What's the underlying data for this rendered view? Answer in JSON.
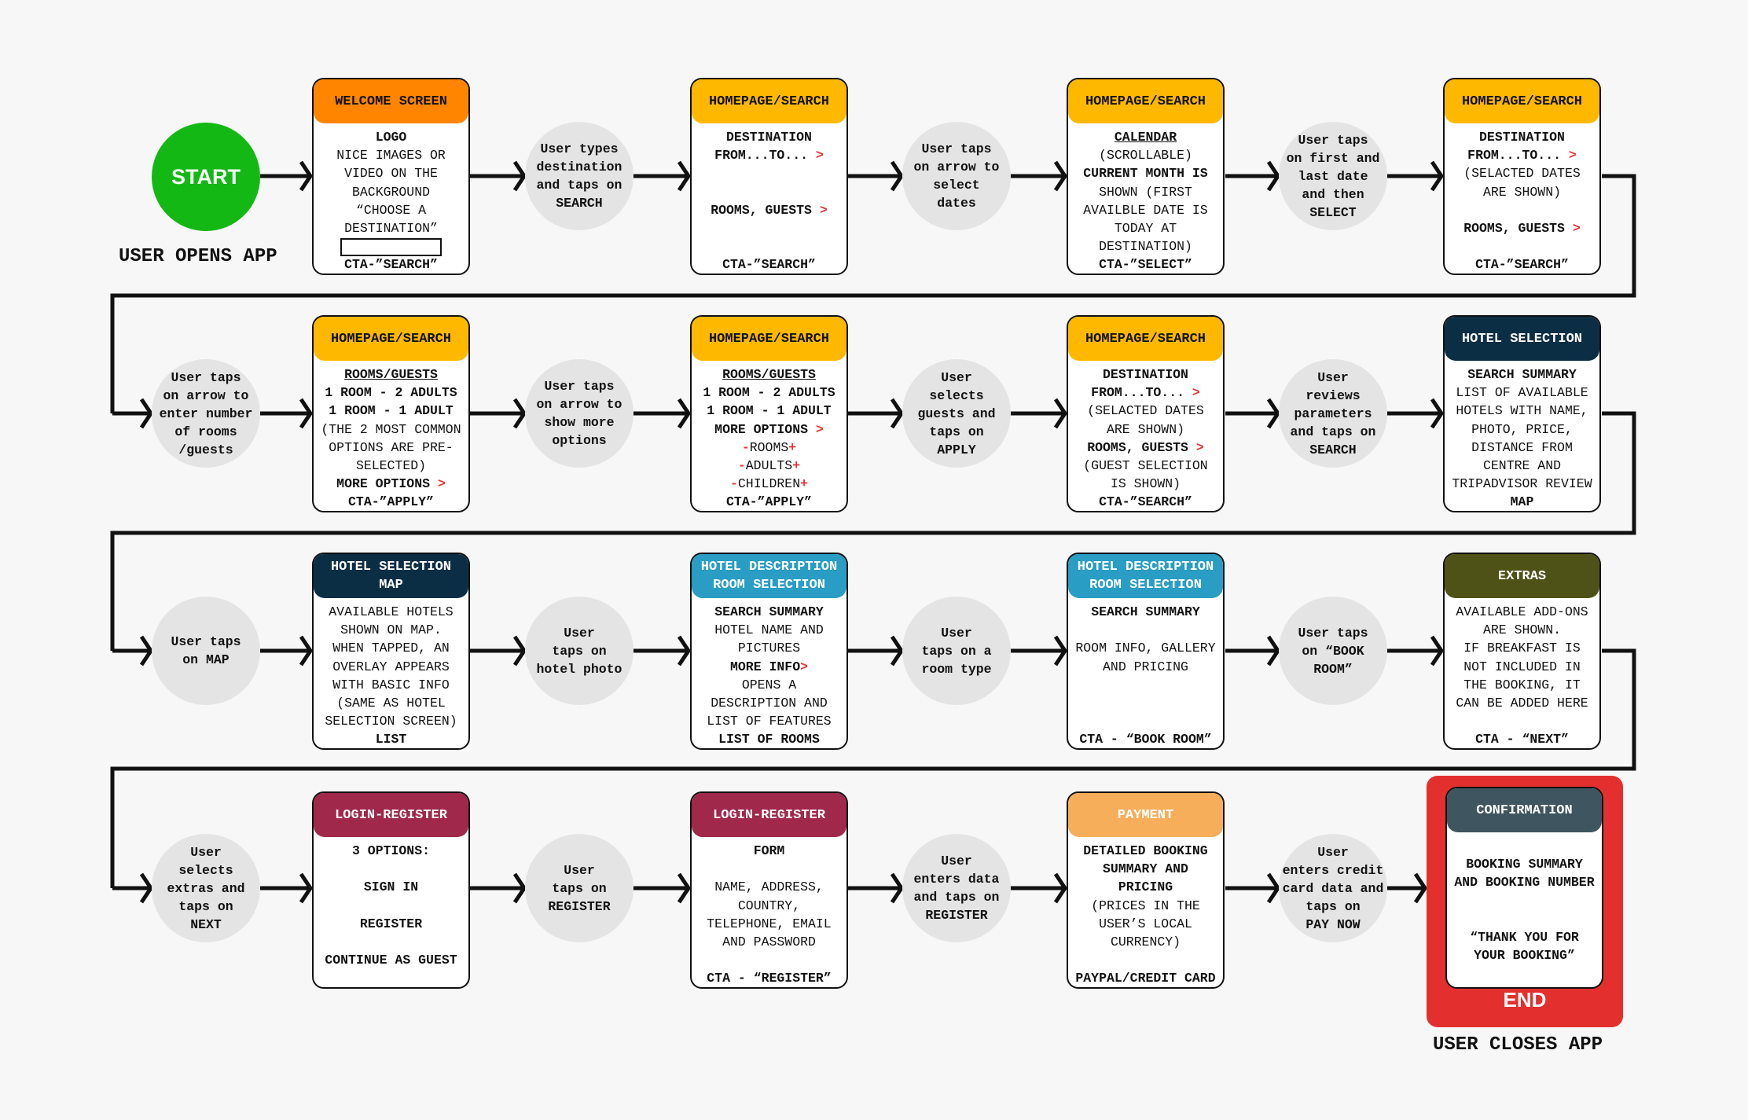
{
  "start": {
    "label": "START",
    "caption": "USER OPENS APP"
  },
  "end": {
    "label": "END",
    "caption": "USER CLOSES APP"
  },
  "colors": {
    "start": "#14b814",
    "end": "#e42f2f",
    "bubble": "#e4e4e4",
    "chevron": "#e8353a"
  },
  "rows": [
    {
      "cards": [
        {
          "title": [
            "WELCOME SCREEN"
          ],
          "color": "#ff8500",
          "text_color": "#111111",
          "lines": [
            {
              "t": "LOGO",
              "b": 1
            },
            {
              "t": "NICE IMAGES OR"
            },
            {
              "t": "VIDEO ON THE"
            },
            {
              "t": "BACKGROUND"
            },
            {
              "t": "“CHOOSE A"
            },
            {
              "t": "DESTINATION”"
            },
            {
              "box": true
            },
            {
              "t": "CTA-”SEARCH”",
              "b": 1
            }
          ]
        },
        {
          "title": [
            "HOMEPAGE/SEARCH"
          ],
          "color": "#ffb800",
          "text_color": "#111111",
          "lines": [
            {
              "t": "DESTINATION",
              "b": 1
            },
            {
              "t": "FROM...TO...",
              "post": " >",
              "b": 1
            },
            {
              "t": ""
            },
            {
              "t": ""
            },
            {
              "t": "ROOMS, GUESTS",
              "post": " >",
              "b": 1
            },
            {
              "t": ""
            },
            {
              "t": ""
            },
            {
              "t": "CTA-”SEARCH”",
              "b": 1
            }
          ]
        },
        {
          "title": [
            "HOMEPAGE/SEARCH"
          ],
          "color": "#ffb800",
          "text_color": "#111111",
          "lines": [
            {
              "t": "CALENDAR",
              "u": 1
            },
            {
              "t": "(SCROLLABLE)"
            },
            {
              "t": "CURRENT MONTH IS",
              "b": 1
            },
            {
              "t": "SHOWN (FIRST"
            },
            {
              "t": "AVAILBLE DATE IS"
            },
            {
              "t": "TODAY AT"
            },
            {
              "t": "DESTINATION)"
            },
            {
              "t": "CTA-”SELECT”",
              "b": 1
            }
          ]
        },
        {
          "title": [
            "HOMEPAGE/SEARCH"
          ],
          "color": "#ffb800",
          "text_color": "#111111",
          "lines": [
            {
              "t": "DESTINATION",
              "b": 1
            },
            {
              "t": "FROM...TO...",
              "post": " >",
              "b": 1
            },
            {
              "t": "(SELACTED DATES"
            },
            {
              "t": "ARE SHOWN)"
            },
            {
              "t": ""
            },
            {
              "t": "ROOMS, GUESTS",
              "post": " >",
              "b": 1
            },
            {
              "t": ""
            },
            {
              "t": "CTA-”SEARCH”",
              "b": 1
            }
          ]
        }
      ],
      "bubbles": [
        [
          "User types",
          "destination",
          "and taps on",
          "SEARCH"
        ],
        [
          "User taps",
          "on arrow to",
          "select",
          "dates"
        ],
        [
          "User taps",
          "on first and",
          "last date",
          "and then",
          "SELECT"
        ]
      ]
    },
    {
      "cards": [
        {
          "title": [
            "HOMEPAGE/SEARCH"
          ],
          "color": "#ffb800",
          "text_color": "#111111",
          "lines": [
            {
              "t": "ROOMS/GUESTS",
              "u": 1
            },
            {
              "t": "1 ROOM - 2 ADULTS",
              "b": 1
            },
            {
              "t": "1 ROOM - 1 ADULT",
              "b": 1
            },
            {
              "t": "(THE 2 MOST COMMON"
            },
            {
              "t": "OPTIONS ARE PRE-"
            },
            {
              "t": "SELECTED)"
            },
            {
              "t": "MORE OPTIONS",
              "post": " >",
              "b": 1
            },
            {
              "t": "CTA-”APPLY”",
              "b": 1
            }
          ]
        },
        {
          "title": [
            "HOMEPAGE/SEARCH"
          ],
          "color": "#ffb800",
          "text_color": "#111111",
          "lines": [
            {
              "t": "ROOMS/GUESTS",
              "u": 1
            },
            {
              "t": "1 ROOM - 2 ADULTS",
              "b": 1
            },
            {
              "t": "1 ROOM - 1 ADULT",
              "b": 1
            },
            {
              "t": "MORE OPTIONS",
              "post": " >",
              "b": 1
            },
            {
              "pre": "-",
              "t": "ROOMS",
              "post": "+"
            },
            {
              "pre": "-",
              "t": "ADULTS",
              "post": "+"
            },
            {
              "pre": "-",
              "t": "CHILDREN",
              "post": "+"
            },
            {
              "t": "CTA-”APPLY”",
              "b": 1
            }
          ]
        },
        {
          "title": [
            "HOMEPAGE/SEARCH"
          ],
          "color": "#ffb800",
          "text_color": "#111111",
          "lines": [
            {
              "t": "DESTINATION",
              "b": 1
            },
            {
              "t": "FROM...TO...",
              "post": " >",
              "b": 1
            },
            {
              "t": "(SELACTED DATES"
            },
            {
              "t": "ARE SHOWN)"
            },
            {
              "t": "ROOMS, GUESTS",
              "post": " >",
              "b": 1
            },
            {
              "t": "(GUEST SELECTION"
            },
            {
              "t": "IS SHOWN)"
            },
            {
              "t": "CTA-”SEARCH”",
              "b": 1
            }
          ]
        },
        {
          "title": [
            "HOTEL SELECTION"
          ],
          "color": "#0b2e45",
          "text_color": "#ffffff",
          "lines": [
            {
              "t": "SEARCH SUMMARY",
              "b": 1
            },
            {
              "t": "LIST OF AVAILABLE"
            },
            {
              "t": "HOTELS WITH NAME,"
            },
            {
              "t": "PHOTO, PRICE,"
            },
            {
              "t": "DISTANCE FROM"
            },
            {
              "t": "CENTRE AND"
            },
            {
              "t": "TRIPADVISOR REVIEW"
            },
            {
              "t": "MAP",
              "b": 1
            }
          ]
        }
      ],
      "bubbles": [
        [
          "User taps",
          "on arrow to",
          "enter number",
          "of rooms",
          "/guests"
        ],
        [
          "User taps",
          "on arrow to",
          "show more",
          "options"
        ],
        [
          "User",
          "selects",
          "guests and",
          "taps on",
          "APPLY"
        ],
        [
          "User",
          "reviews",
          "parameters",
          "and taps on",
          "SEARCH"
        ]
      ]
    },
    {
      "cards": [
        {
          "title": [
            "HOTEL SELECTION",
            "MAP"
          ],
          "color": "#0b2e45",
          "text_color": "#ffffff",
          "lines": [
            {
              "t": "AVAILABLE HOTELS"
            },
            {
              "t": "SHOWN ON MAP."
            },
            {
              "t": "WHEN TAPPED, AN"
            },
            {
              "t": "OVERLAY APPEARS"
            },
            {
              "t": "WITH BASIC INFO"
            },
            {
              "t": "(SAME AS HOTEL"
            },
            {
              "t": "SELECTION SCREEN)"
            },
            {
              "t": "LIST",
              "b": 1
            }
          ]
        },
        {
          "title": [
            "HOTEL DESCRIPTION",
            "ROOM SELECTION"
          ],
          "color": "#2a9dc4",
          "text_color": "#ffffff",
          "lines": [
            {
              "t": "SEARCH SUMMARY",
              "b": 1
            },
            {
              "t": "HOTEL NAME AND"
            },
            {
              "t": "PICTURES"
            },
            {
              "t": "MORE INFO",
              "post": ">",
              "b": 1
            },
            {
              "t": "OPENS A"
            },
            {
              "t": "DESCRIPTION AND"
            },
            {
              "t": "LIST OF FEATURES"
            },
            {
              "t": "LIST OF ROOMS",
              "b": 1
            }
          ]
        },
        {
          "title": [
            "HOTEL DESCRIPTION",
            "ROOM SELECTION"
          ],
          "color": "#2a9dc4",
          "text_color": "#ffffff",
          "lines": [
            {
              "t": "SEARCH SUMMARY",
              "b": 1
            },
            {
              "t": ""
            },
            {
              "t": "ROOM INFO, GALLERY"
            },
            {
              "t": "AND PRICING"
            },
            {
              "t": ""
            },
            {
              "t": ""
            },
            {
              "t": ""
            },
            {
              "t": "CTA - “BOOK ROOM”",
              "b": 1
            }
          ]
        },
        {
          "title": [
            "EXTRAS"
          ],
          "color": "#4f5217",
          "text_color": "#ffffff",
          "lines": [
            {
              "t": "AVAILABLE ADD-ONS"
            },
            {
              "t": "ARE SHOWN."
            },
            {
              "t": "IF BREAKFAST IS"
            },
            {
              "t": "NOT INCLUDED IN"
            },
            {
              "t": "THE BOOKING, IT"
            },
            {
              "t": "CAN BE ADDED HERE"
            },
            {
              "t": ""
            },
            {
              "t": "CTA - “NEXT”",
              "b": 1
            }
          ]
        }
      ],
      "bubbles": [
        [
          "User taps",
          "on MAP"
        ],
        [
          "User",
          "taps on",
          "hotel photo"
        ],
        [
          "User",
          "taps on a",
          "room type"
        ],
        [
          "User taps",
          "on “BOOK",
          "ROOM”"
        ]
      ]
    },
    {
      "cards": [
        {
          "title": [
            "LOGIN-REGISTER"
          ],
          "color": "#a0284a",
          "text_color": "#ffffff",
          "lines": [
            {
              "t": "3 OPTIONS:",
              "b": 1
            },
            {
              "t": ""
            },
            {
              "t": "SIGN IN",
              "b": 1
            },
            {
              "t": ""
            },
            {
              "t": "REGISTER",
              "b": 1
            },
            {
              "t": ""
            },
            {
              "t": "CONTINUE AS GUEST",
              "b": 1
            }
          ]
        },
        {
          "title": [
            "LOGIN-REGISTER"
          ],
          "color": "#a0284a",
          "text_color": "#ffffff",
          "lines": [
            {
              "t": "FORM",
              "b": 1
            },
            {
              "t": ""
            },
            {
              "t": "NAME, ADDRESS,"
            },
            {
              "t": "COUNTRY,"
            },
            {
              "t": "TELEPHONE, EMAIL"
            },
            {
              "t": "AND PASSWORD"
            },
            {
              "t": ""
            },
            {
              "t": "CTA - “REGISTER”",
              "b": 1
            }
          ]
        },
        {
          "title": [
            "PAYMENT"
          ],
          "color": "#f6ae5a",
          "text_color": "#ffffff",
          "lines": [
            {
              "t": "DETAILED BOOKING",
              "b": 1
            },
            {
              "t": "SUMMARY AND",
              "b": 1
            },
            {
              "t": "PRICING",
              "b": 1
            },
            {
              "t": "(PRICES IN THE"
            },
            {
              "t": "USER’S LOCAL"
            },
            {
              "t": "CURRENCY)"
            },
            {
              "t": ""
            },
            {
              "t": "PAYPAL/CREDIT CARD",
              "b": 1
            }
          ]
        },
        {
          "title": [
            "CONFIRMATION"
          ],
          "color": "#3f5560",
          "text_color": "#ffffff",
          "lines": [
            {
              "t": ""
            },
            {
              "t": "BOOKING SUMMARY",
              "b": 1
            },
            {
              "t": "AND BOOKING NUMBER",
              "b": 1
            },
            {
              "t": ""
            },
            {
              "t": ""
            },
            {
              "t": "“THANK YOU FOR",
              "b": 1
            },
            {
              "t": "YOUR BOOKING”",
              "b": 1
            }
          ]
        }
      ],
      "bubbles": [
        [
          "User",
          "selects",
          "extras and",
          "taps on",
          "NEXT"
        ],
        [
          "User",
          "taps on",
          "REGISTER"
        ],
        [
          "User",
          "enters data",
          "and taps on",
          "REGISTER"
        ],
        [
          "User",
          "enters credit",
          "card data and",
          "taps on",
          "PAY NOW"
        ]
      ]
    }
  ]
}
